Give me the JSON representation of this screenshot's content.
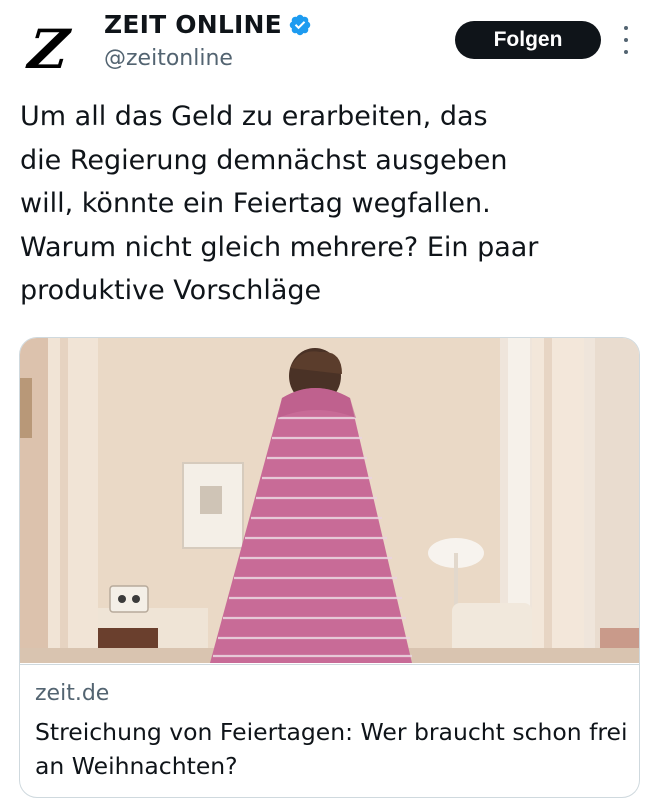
{
  "account": {
    "avatar_letter": "Z",
    "display_name": "ZEIT ONLINE",
    "handle": "@zeitonline",
    "verified": true,
    "verified_color": "#1d9bf0"
  },
  "actions": {
    "follow_label": "Folgen",
    "more_icon": "more-vertical-icon"
  },
  "tweet": {
    "text": "Um all das Geld zu erarbeiten, das\ndie Regierung demnächst ausgeben\nwill, könnte ein Feiertag wegfallen.\nWarum nicht gleich mehrere? Ein paar\nproduktive Vorschläge"
  },
  "link_card": {
    "domain": "zeit.de",
    "title": "Streichung von Feiertagen: Wer braucht schon frei an Weihnachten?",
    "image_subject": "person wrapped in pink striped blanket in a living room"
  },
  "colors": {
    "text_primary": "#0f1419",
    "text_secondary": "#536471",
    "border": "#cfd9de",
    "button_bg": "#0f1419"
  }
}
